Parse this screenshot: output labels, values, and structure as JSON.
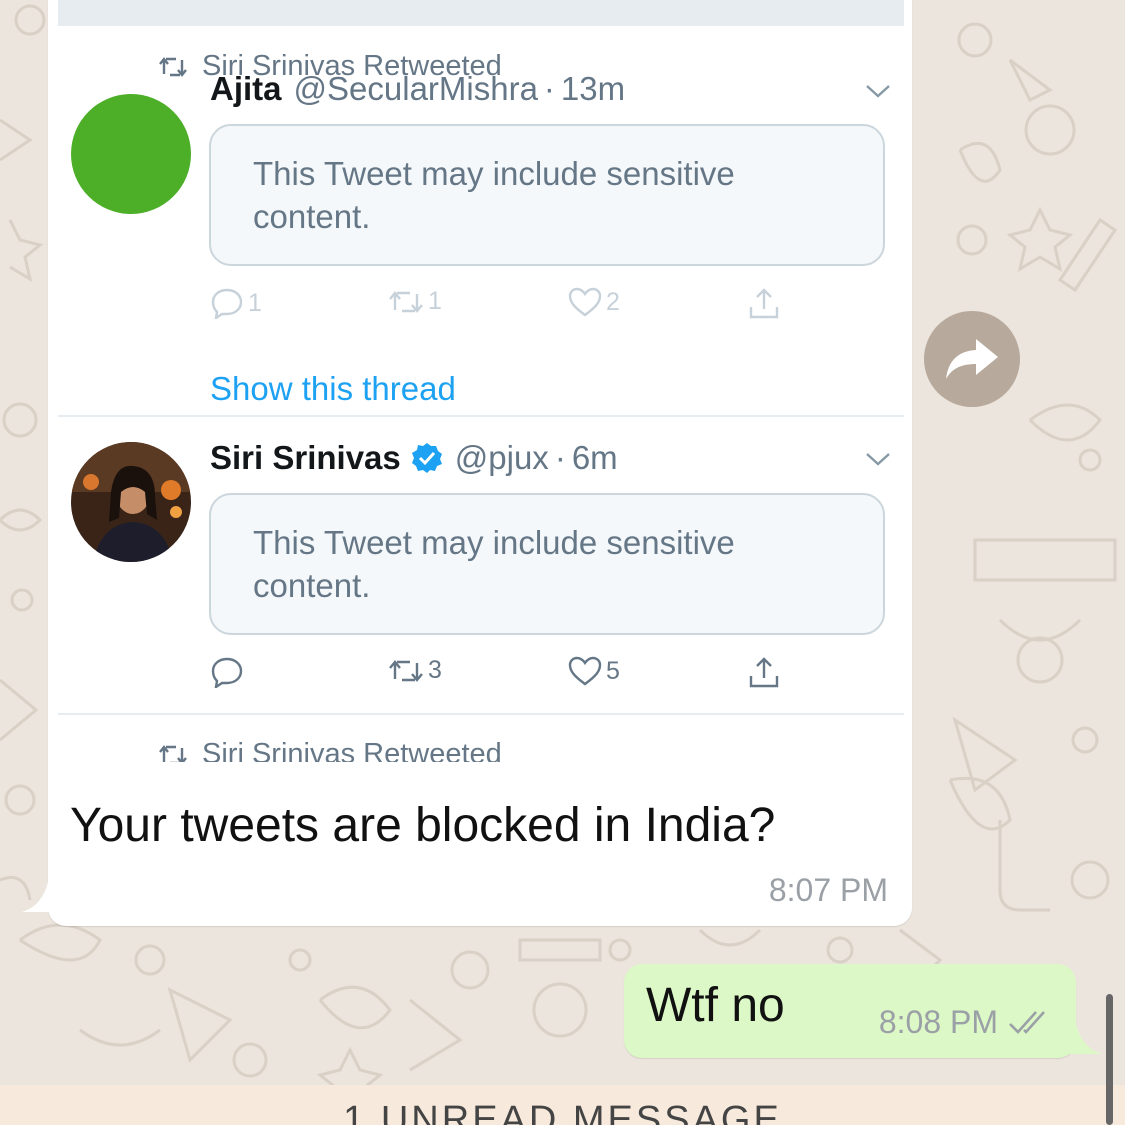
{
  "chat": {
    "incoming": {
      "text": "Your tweets are blocked in India?",
      "time": "8:07 PM",
      "attachment": {
        "tweets": [
          {
            "retweet_label": "Siri Srinivas Retweeted",
            "author": "Ajita",
            "handle": "@SecularMishra",
            "dot": "·",
            "age": "13m",
            "notice": "This Tweet may include sensitive content.",
            "replies": "1",
            "retweets": "1",
            "likes": "2",
            "show_thread": "Show this thread"
          },
          {
            "author": "Siri Srinivas",
            "handle": "@pjux",
            "dot": "·",
            "age": "6m",
            "notice": "This Tweet may include sensitive content.",
            "replies": "",
            "retweets": "3",
            "likes": "5"
          },
          {
            "retweet_label": "Siri Srinivas Retweeted"
          }
        ]
      }
    },
    "outgoing": {
      "text": "Wtf no",
      "time": "8:08 PM",
      "status_icon": "double-check-icon"
    },
    "unread_banner": "1 UNREAD MESSAGE"
  },
  "colors": {
    "wallpaper": "#ece5dd",
    "incoming_bubble": "#ffffff",
    "outgoing_bubble": "#dcf8c6",
    "twitter_blue": "#1da1f2",
    "avatar_green": "#4caf27"
  }
}
